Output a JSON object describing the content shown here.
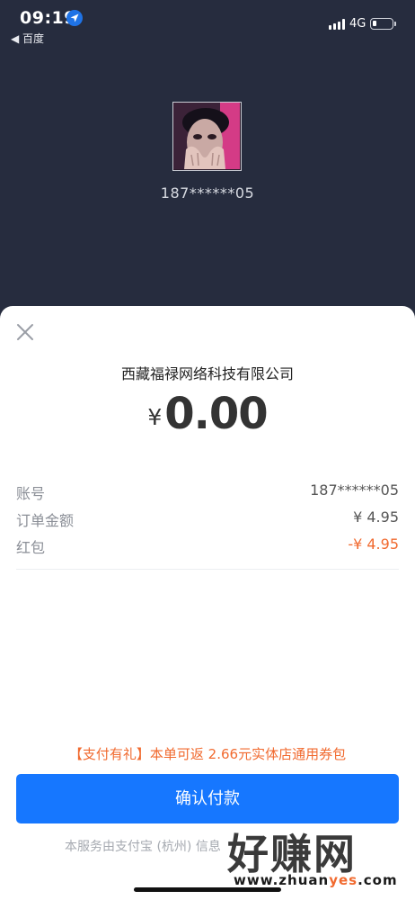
{
  "status_bar": {
    "time": "09:19",
    "back_app": "◀ 百度",
    "network": "4G",
    "icons": [
      "location-icon",
      "signal-icon",
      "battery-icon"
    ]
  },
  "header": {
    "account": "187******05"
  },
  "payment": {
    "merchant": "西藏福禄网络科技有限公司",
    "currency_symbol": "¥",
    "amount": "0.00",
    "details": [
      {
        "label": "账号",
        "value": "187******05"
      },
      {
        "label": "订单金额",
        "value": "¥ 4.95"
      },
      {
        "label": "红包",
        "value": "-¥ 4.95"
      }
    ],
    "promo": "【支付有礼】本单可返 2.66元实体店通用券包",
    "confirm_label": "确认付款",
    "footer_note": "本服务由支付宝 (杭州) 信息"
  },
  "watermark": {
    "title": "好赚网",
    "url_prefix": "www.zhuan",
    "url_highlight": "yes",
    "url_suffix": ".com"
  },
  "colors": {
    "header_bg": "#262c3e",
    "accent_blue": "#1677ff",
    "accent_orange": "#f16a2f"
  }
}
